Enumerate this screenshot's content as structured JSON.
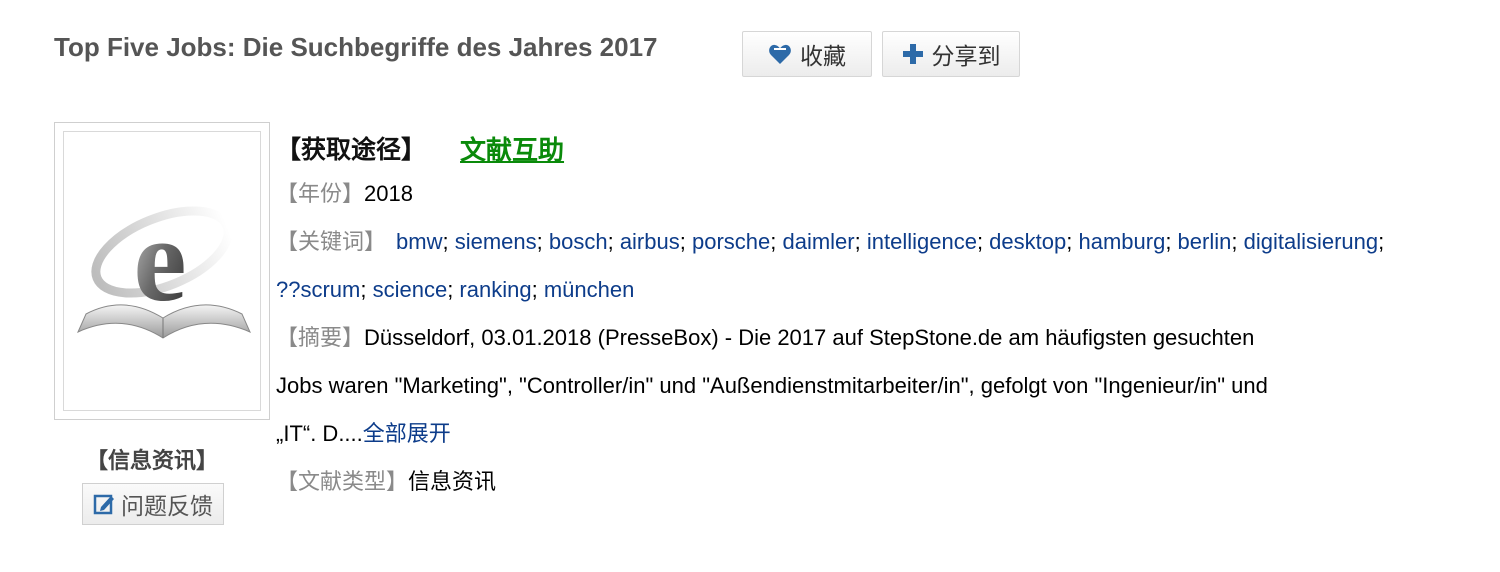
{
  "title": "Top Five Jobs: Die Suchbegriffe des Jahres 2017",
  "actions": {
    "favorite_label": "收藏",
    "share_label": "分享到"
  },
  "sidebar": {
    "category_label": "【信息资讯】",
    "feedback_label": "问题反馈"
  },
  "record": {
    "access_label": "【获取途径】",
    "access_link": "文献互助",
    "year_label": "【年份】",
    "year_value": "2018",
    "keywords_label": "【关键词】",
    "keywords": [
      "bmw",
      "siemens",
      "bosch",
      "airbus",
      "porsche",
      "daimler",
      "intelligence",
      "desktop",
      "hamburg",
      "berlin",
      "digitalisierung",
      "??scrum",
      "science",
      "ranking",
      "münchen"
    ],
    "abstract_label": "【摘要】",
    "abstract_line1": "Düsseldorf, 03.01.2018 (PresseBox) - Die 2017 auf StepStone.de am häufigsten gesuchten",
    "abstract_line2": "Jobs waren \"Marketing\", \"Controller/in\" und \"Außendienstmitarbeiter/in\", gefolgt von \"Ingenieur/in\" und",
    "abstract_line3": "„IT“. D....",
    "expand_label": "全部展开",
    "type_label": "【文献类型】",
    "type_value": "信息资讯"
  },
  "colors": {
    "link_blue": "#0d3c8a",
    "access_green": "#0a8a0a",
    "label_gray": "#8a8a8a",
    "title_gray": "#555555"
  }
}
